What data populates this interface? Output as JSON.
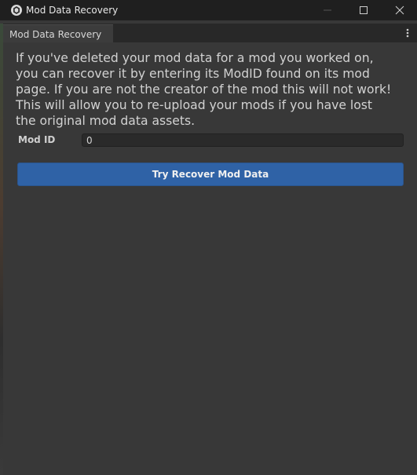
{
  "window": {
    "title": "Mod Data Recovery",
    "icon": "unity-logo-icon",
    "controls": {
      "minimize": "minimize-icon",
      "maximize": "maximize-icon",
      "close": "close-icon"
    }
  },
  "tab": {
    "label": "Mod Data Recovery",
    "menu_icon": "kebab-menu-icon"
  },
  "main": {
    "description": "If you've deleted your mod data for a mod you worked on, you can recover it by entering its ModID found on its mod page. If you are not the creator of the mod this will not work! This will allow you to re-upload your mods if you have lost the original mod data assets.",
    "mod_id_label": "Mod ID",
    "mod_id_value": "0",
    "recover_button_label": "Try Recover Mod Data"
  },
  "colors": {
    "background": "#383838",
    "titlebar": "#1f1f1f",
    "accent_button": "#2f62a6",
    "text": "#d2d2d2"
  }
}
